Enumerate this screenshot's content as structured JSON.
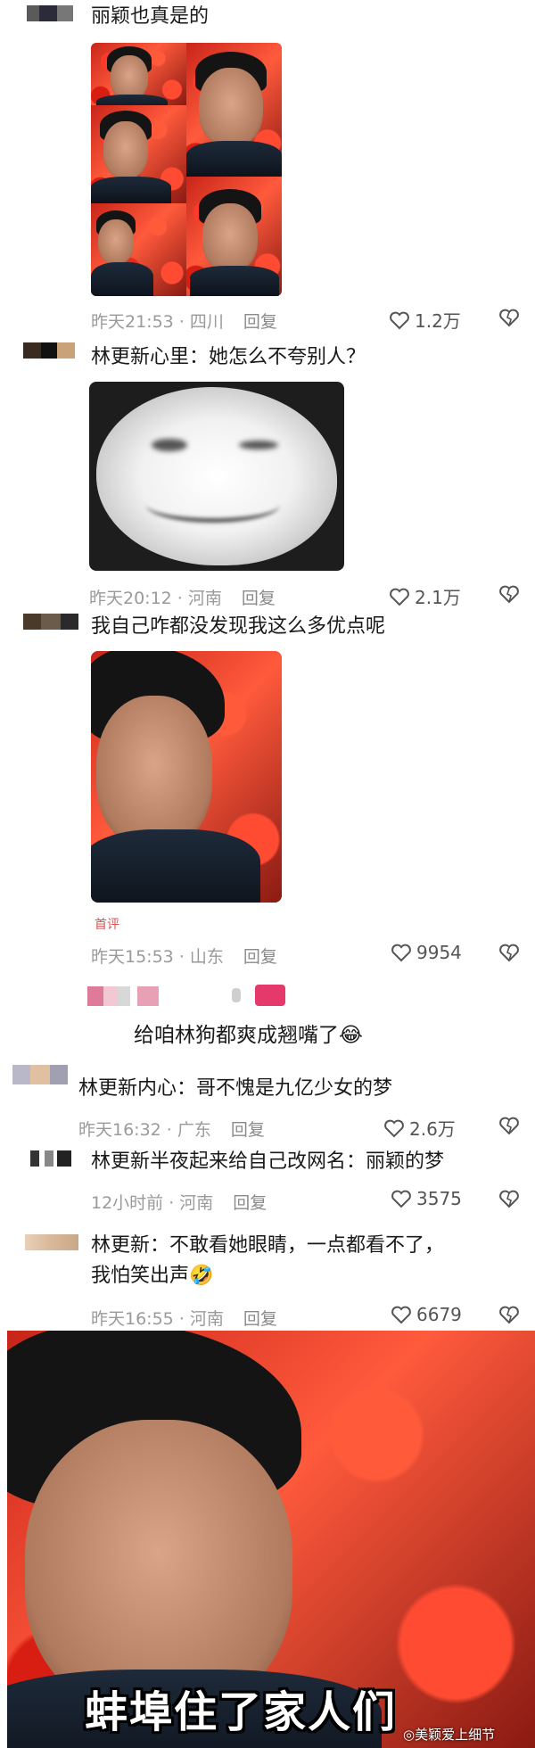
{
  "comments": [
    {
      "text": "丽颖也真是的",
      "time_place": "昨天21:53 · 四川",
      "reply": "回复",
      "likes": "1.2万"
    },
    {
      "text": "林更新心里：她怎么不夸别人？",
      "time_place": "昨天20:12 · 河南",
      "reply": "回复",
      "likes": "2.1万"
    },
    {
      "text": "我自己咋都没发现我这么多优点呢",
      "badge": "首评",
      "time_place": "昨天15:53 · 山东",
      "reply": "回复",
      "likes": "9954"
    },
    {
      "text": "给咱林狗都爽成翘嘴了😂"
    },
    {
      "text": "林更新内心：哥不愧是九亿少女的梦",
      "time_place": "昨天16:32 · 广东",
      "reply": "回复",
      "likes": "2.6万"
    },
    {
      "text": "林更新半夜起来给自己改网名：丽颖的梦",
      "time_place": "12小时前 · 河南",
      "reply": "回复",
      "likes": "3575"
    },
    {
      "text_line1": "林更新：不敢看她眼睛，一点都看不了，",
      "text_line2": "我怕笑出声🤣",
      "time_place": "昨天16:55 · 河南",
      "reply": "回复",
      "likes": "6679"
    }
  ],
  "banner": {
    "caption": "蚌埠住了家人们",
    "watermark": "◎美颖爱上细节"
  },
  "colors": {
    "meta": "#9a9a9a",
    "badge": "#d9534f",
    "flowers": "#ff3a2a"
  },
  "icons": {
    "like": "heart-icon",
    "dislike": "broken-heart-icon"
  }
}
